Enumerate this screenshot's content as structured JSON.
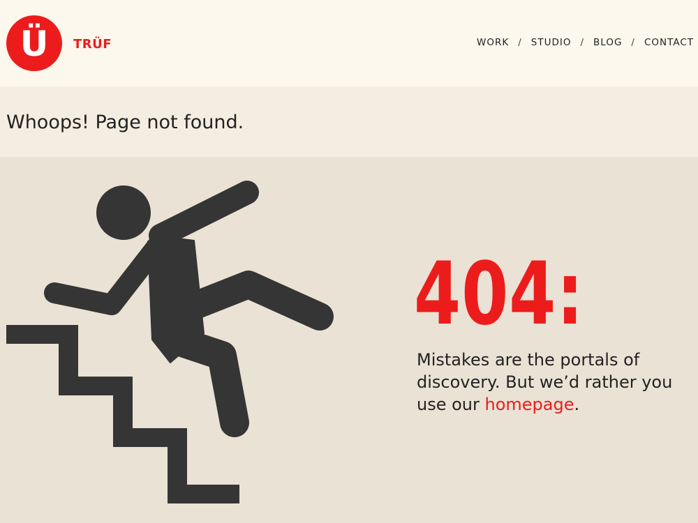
{
  "header": {
    "logo_letter": "Ü",
    "brand_name": "TRÜF",
    "nav": {
      "items": [
        "WORK",
        "STUDIO",
        "BLOG",
        "CONTACT"
      ],
      "separator": "/"
    }
  },
  "title_band": {
    "title": "Whoops! Page not found."
  },
  "main": {
    "error_code": "404:",
    "message_before_link": "Mistakes are the portals of discovery. But we’d rather you use our ",
    "link_text": "homepage",
    "message_after_link": "."
  },
  "illustration_icon": "person-falling-down-stairs-icon",
  "colors": {
    "accent": "#ed1c1c",
    "header_bg": "#fcf8ee",
    "title_band_bg": "#f4ede1",
    "main_bg": "#eae2d4",
    "figure": "#363535"
  }
}
